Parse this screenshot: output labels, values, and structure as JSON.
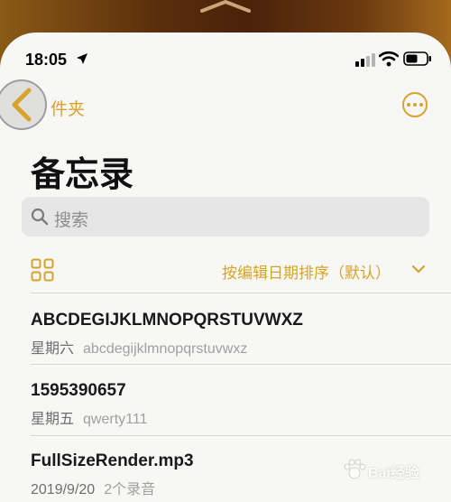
{
  "status_bar": {
    "time": "18:05"
  },
  "nav": {
    "back_label": "件夹"
  },
  "page": {
    "title": "备忘录"
  },
  "search": {
    "placeholder": "搜索"
  },
  "toolbar": {
    "sort_label": "按编辑日期排序（默认）"
  },
  "notes": [
    {
      "title": "ABCDEGIJKLMNOPQRSTUVWXZ",
      "date": "星期六",
      "preview": "abcdegijklmnopqrstuvwxz"
    },
    {
      "title": "1595390657",
      "date": "星期五",
      "preview": "qwerty111"
    },
    {
      "title": "FullSizeRender.mp3",
      "date": "2019/9/20",
      "preview": "2个录音"
    }
  ],
  "watermark": {
    "text": "Bai经验"
  },
  "colors": {
    "accent": "#d8a32c",
    "background": "#f7f7f5",
    "search_bg": "#e6e6e6"
  }
}
